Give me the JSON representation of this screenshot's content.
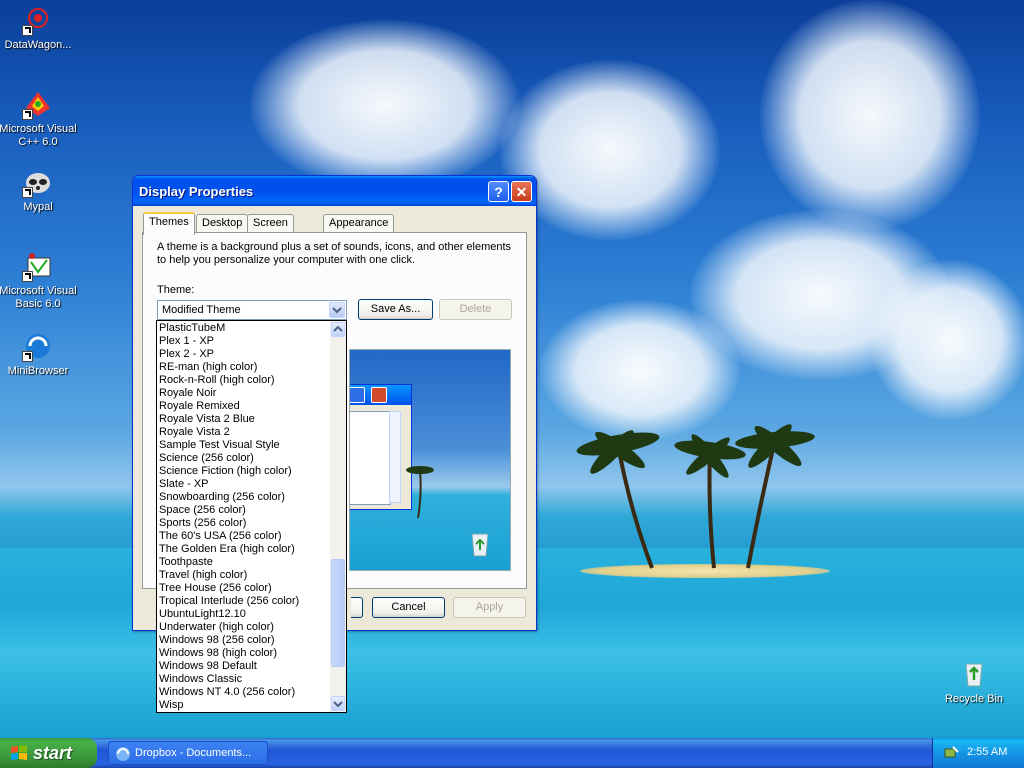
{
  "desktop": {
    "icons": [
      {
        "label": "DataWagon..."
      },
      {
        "label": "Microsoft Visual C++ 6.0"
      },
      {
        "label": "Mypal"
      },
      {
        "label": "Microsoft Visual Basic 6.0"
      },
      {
        "label": "MiniBrowser"
      },
      {
        "label": "Recycle Bin"
      }
    ]
  },
  "window": {
    "title": "Display Properties",
    "help_glyph": "?",
    "close_glyph": "✕",
    "tabs": [
      "Themes",
      "Desktop",
      "Screen Saver",
      "Appearance"
    ],
    "active_tab": "Themes",
    "intro_text": "A theme is a background plus a set of sounds, icons, and other elements to help you personalize your computer with one click.",
    "theme_label": "Theme:",
    "theme_value": "Modified Theme",
    "save_as_label": "Save As...",
    "delete_label": "Delete",
    "cancel_label": "Cancel",
    "apply_label": "Apply"
  },
  "dropdown": {
    "items": [
      "PlasticTubeM",
      "Plex 1 - XP",
      "Plex 2 - XP",
      "RE-man (high color)",
      "Rock-n-Roll (high color)",
      "Royale Noir",
      "Royale Remixed",
      "Royale Vista 2 Blue",
      "Royale Vista 2",
      "Sample Test Visual Style",
      "Science (256 color)",
      "Science Fiction (high color)",
      "Slate - XP",
      "Snowboarding (256 color)",
      "Space (256 color)",
      "Sports (256 color)",
      "The 60's USA (256 color)",
      "The Golden Era (high color)",
      "Toothpaste",
      "Travel (high color)",
      "Tree House (256 color)",
      "Tropical Interlude (256 color)",
      "UbuntuLight12.10",
      "Underwater (high color)",
      "Windows 98 (256 color)",
      "Windows 98 (high color)",
      "Windows 98 Default",
      "Windows Classic",
      "Windows NT 4.0 (256 color)",
      "Wisp"
    ]
  },
  "taskbar": {
    "start_label": "start",
    "task_label": "Dropbox - Documents...",
    "clock": "2:55 AM"
  },
  "colors": {
    "titlebar_blue": "#0050ee",
    "start_green": "#3a943a",
    "tray_blue": "#1594e6"
  }
}
